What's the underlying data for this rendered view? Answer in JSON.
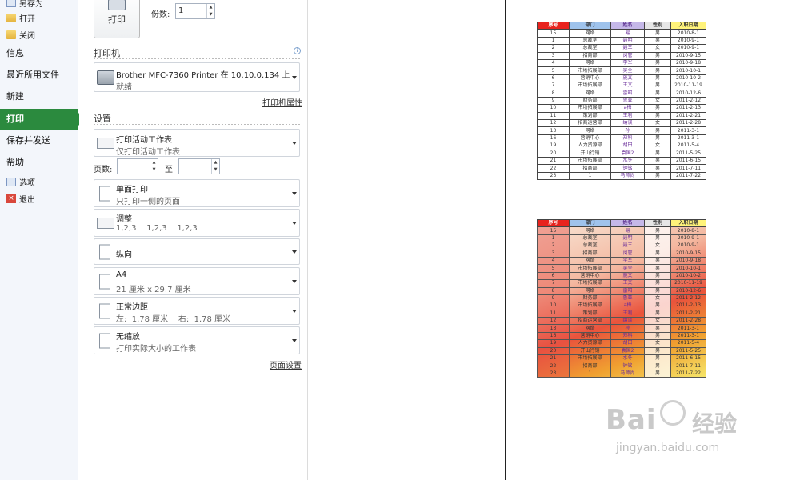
{
  "nav": {
    "small_top": [
      {
        "label": "另存为",
        "icon": "save-as-icon"
      },
      {
        "label": "打开",
        "icon": "folder-icon"
      },
      {
        "label": "关闭",
        "icon": "folder-icon"
      }
    ],
    "big": [
      "信息",
      "最近所用文件",
      "新建",
      "打印",
      "保存并发送",
      "帮助"
    ],
    "active": "打印",
    "small_bottom": [
      {
        "label": "选项",
        "icon": "options-icon"
      },
      {
        "label": "退出",
        "icon": "exit-icon"
      }
    ]
  },
  "print": {
    "button_label": "打印",
    "copies_label": "份数:",
    "copies_value": "1"
  },
  "printer": {
    "section_title": "打印机",
    "name": "Brother MFC-7360 Printer 在 10.10.0.134 上",
    "status": "就绪",
    "properties_link": "打印机属性"
  },
  "settings": {
    "section_title": "设置",
    "scope": {
      "title": "打印活动工作表",
      "subtitle": "仅打印活动工作表"
    },
    "pages_label": "页数:",
    "pages_to": "至",
    "sides": {
      "title": "单面打印",
      "subtitle": "只打印一侧的页面"
    },
    "collate": {
      "title": "调整",
      "subtitle": "1,2,3    1,2,3    1,2,3"
    },
    "orientation": {
      "title": "纵向"
    },
    "paper": {
      "title": "A4",
      "subtitle": "21 厘米 x 29.7 厘米"
    },
    "margins": {
      "title": "正常边距",
      "subtitle": "左:  1.78 厘米    右:  1.78 厘米"
    },
    "scaling": {
      "title": "无缩放",
      "subtitle": "打印实际大小的工作表"
    },
    "page_setup_link": "页面设置"
  },
  "preview": {
    "headers": [
      "序号",
      "部门",
      "姓名",
      "性别",
      "入职日期"
    ],
    "rows": [
      [
        "15",
        "网络",
        "易",
        "男",
        "2010-8-1"
      ],
      [
        "1",
        "总裁室",
        "聂明",
        "男",
        "2010-9-1"
      ],
      [
        "2",
        "总裁室",
        "聂三",
        "女",
        "2010-9-1"
      ],
      [
        "3",
        "招商部",
        "闵管",
        "男",
        "2010-9-15"
      ],
      [
        "4",
        "网络",
        "李军",
        "男",
        "2010-9-18"
      ],
      [
        "5",
        "市场拓展部",
        "吴全",
        "男",
        "2010-10-1"
      ],
      [
        "6",
        "营销中心",
        "施文",
        "男",
        "2010-10-2"
      ],
      [
        "7",
        "市场拓展部",
        "王文",
        "男",
        "2010-11-19"
      ],
      [
        "8",
        "网络",
        "雷昭",
        "男",
        "2010-12-6"
      ],
      [
        "9",
        "财务部",
        "鲁亚",
        "女",
        "2011-2-12"
      ],
      [
        "10",
        "市场拓展部",
        "a梅",
        "男",
        "2011-2-13"
      ],
      [
        "11",
        "策划部",
        "王利",
        "男",
        "2011-2-21"
      ],
      [
        "12",
        "招商运营部",
        "纳谈",
        "女",
        "2011-2-28"
      ],
      [
        "13",
        "网络",
        "孙",
        "男",
        "2011-3-1"
      ],
      [
        "16",
        "营销中心",
        "郑科",
        "男",
        "2011-3-1"
      ],
      [
        "19",
        "人力资源部",
        "胡田",
        "女",
        "2011-5-4"
      ],
      [
        "20",
        "开山行销",
        "袁国2",
        "男",
        "2011-5-25"
      ],
      [
        "21",
        "市场拓展部",
        "水冬",
        "男",
        "2011-6-15"
      ],
      [
        "22",
        "招商部",
        "钟铭",
        "男",
        "2011-7-11"
      ],
      [
        "23",
        "1",
        "马师尚",
        "男",
        "2011-7-22"
      ]
    ]
  },
  "watermark": {
    "brand": "Bai",
    "suffix": "经验",
    "url": "jingyan.baidu.com"
  }
}
